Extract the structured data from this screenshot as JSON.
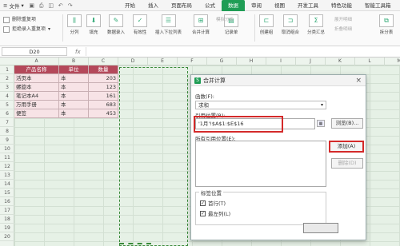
{
  "menubar": {
    "file_label": "文件",
    "tabs": [
      "开始",
      "插入",
      "页面布局",
      "公式",
      "数据",
      "审阅",
      "视图",
      "开发工具",
      "特色功能",
      "智能工具箱"
    ],
    "active_tab": "数据"
  },
  "ribbon": {
    "left_items": [
      "删除重复项",
      "拒绝录入重复项"
    ],
    "groups": [
      "分列",
      "填充",
      "数据录入",
      "有效性",
      "插入下拉列表",
      "合并计算",
      "记录单",
      "创建组",
      "取消组合",
      "分类汇总",
      "拆分表"
    ],
    "faded": [
      "模拟分析",
      "展开明细",
      "折叠明细"
    ]
  },
  "formula_bar": {
    "name_box": "D20",
    "fx": "fx"
  },
  "grid": {
    "columns": [
      "A",
      "B",
      "C",
      "D",
      "E",
      "F",
      "G",
      "H",
      "I",
      "J",
      "K",
      "L",
      "M"
    ],
    "rows": [
      "1",
      "2",
      "3",
      "4",
      "5",
      "6",
      "7",
      "8",
      "9",
      "10",
      "11",
      "12",
      "13",
      "14",
      "15",
      "16",
      "17",
      "18",
      "19",
      "20"
    ],
    "table": {
      "headers": [
        "产品名称",
        "单位",
        "数量"
      ],
      "rows": [
        [
          "活页本",
          "本",
          "203"
        ],
        [
          "螺旋本",
          "本",
          "123"
        ],
        [
          "笔记本A4",
          "本",
          "161"
        ],
        [
          "万用手册",
          "本",
          "683"
        ],
        [
          "便签",
          "本",
          "453"
        ]
      ]
    }
  },
  "dialog": {
    "title": "合并计算",
    "function_label": "函数(F):",
    "function_value": "求和",
    "ref_label": "引用位置(R):",
    "ref_value": "'1月'!$A$1:$E$16",
    "browse_label": "浏览(B)...",
    "all_refs_label": "所有引用位置(E):",
    "add_label": "添加(A)",
    "delete_label": "删除(D)",
    "label_pos_label": "标签位置",
    "first_row_label": "首行(T)",
    "left_col_label": "最左列(L)",
    "first_row_checked": true,
    "left_col_checked": true
  }
}
